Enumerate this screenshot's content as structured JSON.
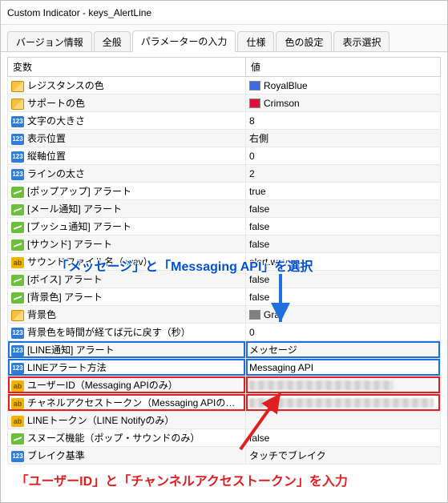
{
  "window": {
    "title": "Custom Indicator - keys_AlertLine"
  },
  "tabs": [
    {
      "label": "バージョン情報"
    },
    {
      "label": "全般"
    },
    {
      "label": "パラメーターの入力",
      "active": true
    },
    {
      "label": "仕様"
    },
    {
      "label": "色の設定"
    },
    {
      "label": "表示選択"
    }
  ],
  "columns": {
    "var": "変数",
    "val": "値"
  },
  "rows": [
    {
      "icon": "color",
      "name": "レジスタンスの色",
      "value": "RoyalBlue",
      "swatch": "#4169e1"
    },
    {
      "icon": "color",
      "name": "サポートの色",
      "value": "Crimson",
      "swatch": "#dc143c"
    },
    {
      "icon": "123",
      "name": "文字の大きさ",
      "value": "8"
    },
    {
      "icon": "123",
      "name": "表示位置",
      "value": "右側"
    },
    {
      "icon": "123",
      "name": "縦軸位置",
      "value": "0"
    },
    {
      "icon": "123",
      "name": "ラインの太さ",
      "value": "2"
    },
    {
      "icon": "bool",
      "name": "[ポップアップ] アラート",
      "value": "true"
    },
    {
      "icon": "bool",
      "name": "[メール通知] アラート",
      "value": "false"
    },
    {
      "icon": "bool",
      "name": "[プッシュ通知] アラート",
      "value": "false"
    },
    {
      "icon": "bool",
      "name": "[サウンド] アラート",
      "value": "false"
    },
    {
      "icon": "ab",
      "name": "サウンドファイル名（.wav）",
      "value": "alert.wav"
    },
    {
      "icon": "bool",
      "name": "[ボイス] アラート",
      "value": "false"
    },
    {
      "icon": "bool",
      "name": "[背景色] アラート",
      "value": "false"
    },
    {
      "icon": "color",
      "name": "背景色",
      "value": "Gray",
      "swatch": "#808080"
    },
    {
      "icon": "123",
      "name": "背景色を時間が経てば元に戻す（秒）",
      "value": "0"
    },
    {
      "icon": "123",
      "name": "[LINE通知] アラート",
      "value": "メッセージ",
      "hl": "blue"
    },
    {
      "icon": "123",
      "name": "LINEアラート方法",
      "value": "Messaging API",
      "hl": "blue"
    },
    {
      "icon": "ab",
      "name": "ユーザーID（Messaging APIのみ）",
      "value": "",
      "obscured": true,
      "hl": "red",
      "obw": 180
    },
    {
      "icon": "ab",
      "name": "チャネルアクセストークン（Messaging APIのみ）",
      "value": "",
      "obscured": true,
      "hl": "red",
      "obw": 230
    },
    {
      "icon": "ab",
      "name": "LINEトークン（LINE Notifyのみ）",
      "value": ""
    },
    {
      "icon": "bool",
      "name": "スヌーズ機能（ポップ・サウンドのみ）",
      "value": "false"
    },
    {
      "icon": "123",
      "name": "ブレイク基準",
      "value": "タッチでブレイク"
    }
  ],
  "annotations": {
    "top": "「メッセージ」と「Messaging API」を選択",
    "bottom": "「ユーザーID」と「チャンネルアクセストークン」を入力"
  }
}
